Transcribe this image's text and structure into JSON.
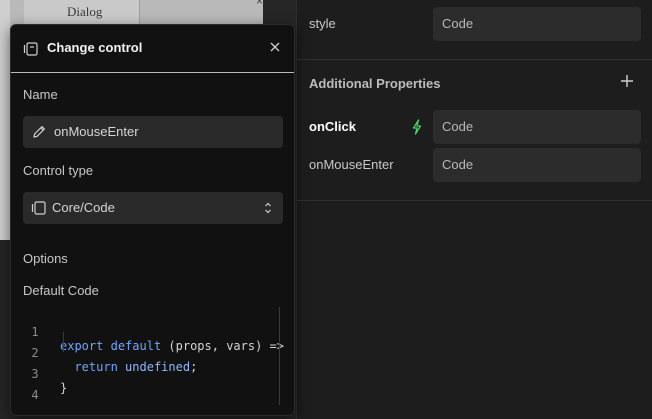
{
  "canvas": {
    "dialog_label": "Dialog",
    "corner_glyph": "×"
  },
  "properties": {
    "rows": [
      {
        "label": "style",
        "value": "Code"
      },
      {
        "label": "onClick",
        "value": "Code",
        "active": true,
        "icon": "bolt-icon"
      },
      {
        "label": "onMouseEnter",
        "value": "Code"
      }
    ],
    "section_title": "Additional Properties",
    "add_icon": "plus-icon"
  },
  "popover": {
    "title": "Change control",
    "header_icon": "control-icon",
    "close_icon": "close-icon",
    "name_label": "Name",
    "name_value": "onMouseEnter",
    "name_icon": "pencil-icon",
    "control_type_label": "Control type",
    "control_type_value": "Core/Code",
    "control_type_icon": "control-icon",
    "options_label": "Options",
    "default_code_label": "Default Code",
    "code_lines": [
      {
        "n": "1",
        "text": "export default (props, vars) =>"
      },
      {
        "n": "2",
        "text": "  return undefined;"
      },
      {
        "n": "3",
        "text": "}"
      },
      {
        "n": "4",
        "text": ""
      }
    ]
  },
  "colors": {
    "panel_bg": "#1d1d1d",
    "popover_bg": "#111111",
    "field_bg": "#2a2a2a",
    "keyword": "#6aa6ff",
    "bolt": "#4fd36b"
  }
}
